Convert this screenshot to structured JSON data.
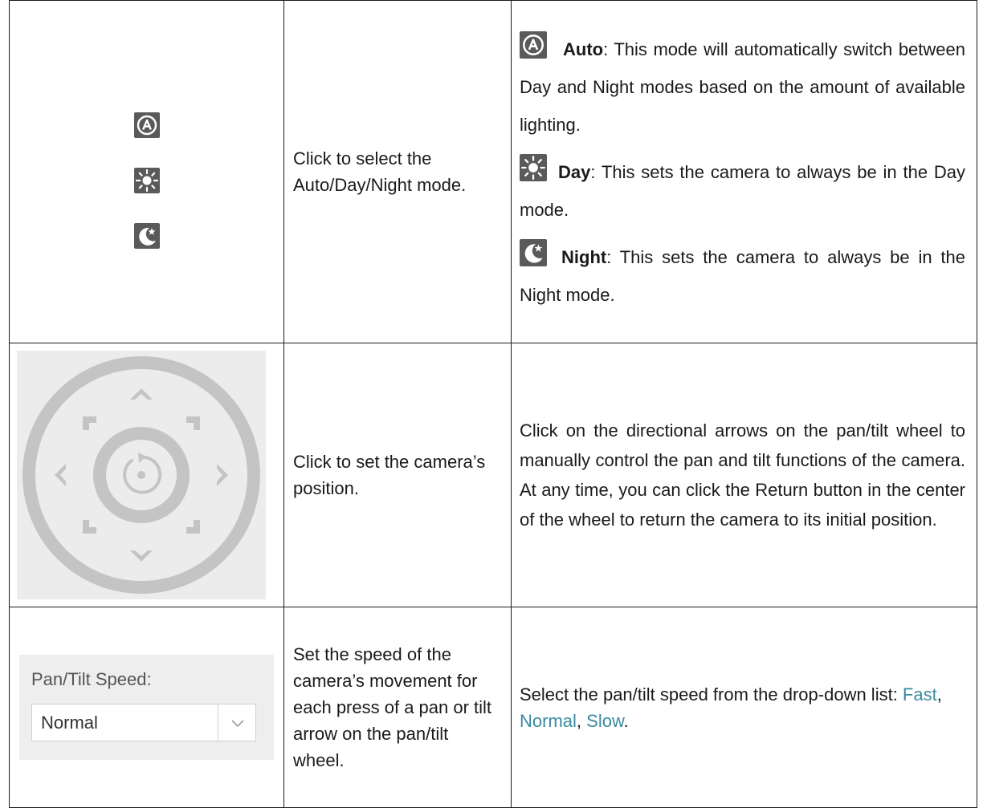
{
  "rows": [
    {
      "control_description": "Click to select the Auto/Day/Night mode.",
      "details": [
        {
          "icon": "auto-mode-icon",
          "term": "Auto",
          "text": ": This mode will automatically switch between Day and Night modes based on the amount of available lighting."
        },
        {
          "icon": "day-mode-icon",
          "term": "Day",
          "text": ": This sets the camera to always be in the Day mode."
        },
        {
          "icon": "night-mode-icon",
          "term": "Night",
          "text": ": This sets the camera to always be in the Night mode."
        }
      ]
    },
    {
      "control_description": "Click to set the camera’s position.",
      "details_text": "Click on the directional arrows on the pan/tilt wheel to manually control the pan and tilt functions of the camera. At any time, you can click the Return button in the center of the wheel to return the camera to its initial position."
    },
    {
      "speed_label": "Pan/Tilt Speed:",
      "speed_value": "Normal",
      "control_description": "Set the speed of the camera’s movement for each press of a pan or tilt arrow on the pan/tilt wheel.",
      "details_prefix": "Select the pan/tilt speed from the drop-down list: ",
      "options": [
        "Fast",
        "Normal",
        "Slow"
      ],
      "sep": ", ",
      "end": "."
    }
  ],
  "colors": {
    "icon_bg": "#5a5a5a",
    "wheel": "#c4c4c4",
    "option_link": "#3a8aa0"
  }
}
